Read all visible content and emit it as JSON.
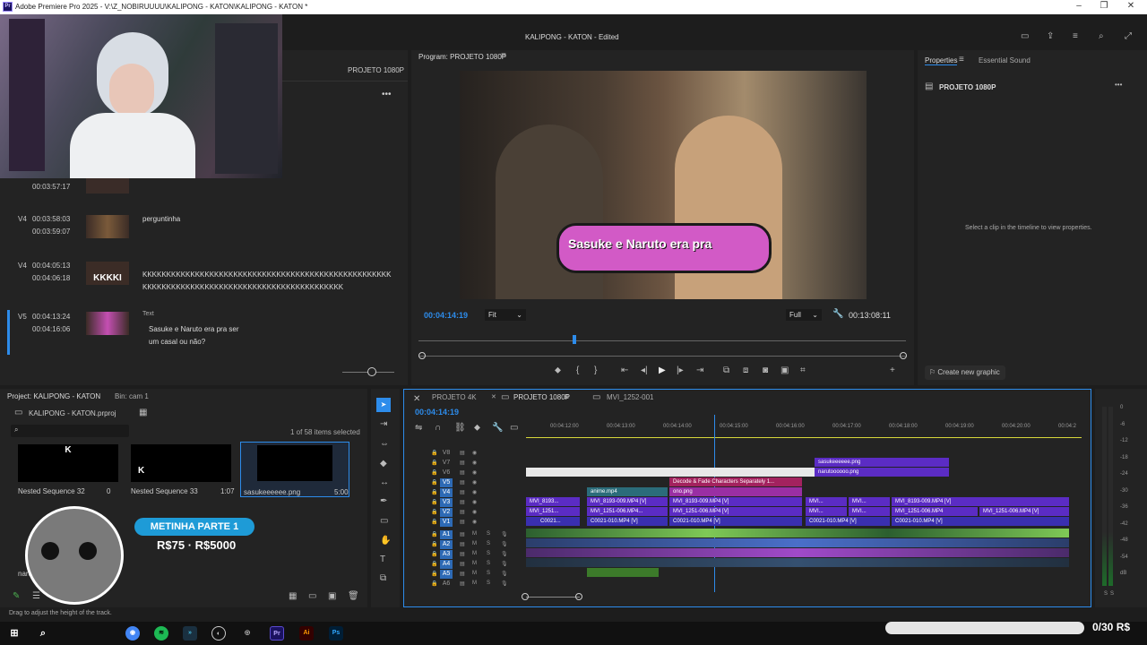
{
  "window": {
    "title": "Adobe Premiere Pro 2025 - V:\\Z_NOBIRUUUU\\KALIPONG - KATON\\KALIPONG - KATON *",
    "doc_title": "KALIPONG - KATON - Edited"
  },
  "source_panel": {
    "seq_name": "PROJETO 1080P",
    "rows": [
      {
        "track": "",
        "tin": "00:03:57:17",
        "tout": "",
        "text": "",
        "text2": ""
      },
      {
        "track": "V4",
        "tin": "00:03:58:03",
        "tout": "00:03:59:07",
        "text": "perguntinha",
        "text2": ""
      },
      {
        "track": "V4",
        "tin": "00:04:05:13",
        "tout": "00:04:06:18",
        "text": "KKKKKKKKKKKKKKKKKKKKKKKKKKKKKKKKKKKKKKKKKKKKKKKKKKKK",
        "text2": "KKKKKKKKKKKKKKKKKKKKKKKKKKKKKKKKKKKKKKKKKK"
      },
      {
        "track": "V5",
        "tin": "00:04:13:24",
        "tout": "00:04:16:06",
        "text": "Sasuke e Naruto era pra ser",
        "text2": "um casal ou não?"
      }
    ],
    "text_label": "Text",
    "thumb_text": "KKKKI"
  },
  "program": {
    "label": "Program: PROJETO 1080P",
    "caption": "Sasuke e Naruto era pra",
    "timecode": "00:04:14:19",
    "fit": "Fit",
    "full": "Full",
    "duration": "00:13:08:11"
  },
  "properties": {
    "tab1": "Properties",
    "tab2": "Essential Sound",
    "seq": "PROJETO 1080P",
    "empty": "Select a clip in the timeline to view properties.",
    "create": "Create new graphic"
  },
  "project": {
    "title": "Project: KALIPONG - KATON",
    "bin": "Bin: cam 1",
    "file": "KALIPONG - KATON.prproj",
    "count": "1 of 58 items selected",
    "items": [
      {
        "name": "Nested Sequence 32",
        "dur": "0",
        "letter": "K"
      },
      {
        "name": "Nested Sequence 33",
        "dur": "1:07",
        "letter": "K"
      },
      {
        "name": "sasukeeeeee.png",
        "dur": "5:00",
        "letter": ""
      }
    ],
    "extra": "naruto0000.png"
  },
  "timeline": {
    "tabs": [
      "PROJETO 4K",
      "PROJETO 1080P",
      "MVI_1252-001"
    ],
    "timecode": "00:04:14:19",
    "ruler": [
      "00:04:12:00",
      "00:04:13:00",
      "00:04:14:00",
      "00:04:15:00",
      "00:04:16:00",
      "00:04:17:00",
      "00:04:18:00",
      "00:04:19:00",
      "00:04:20:00",
      "00:04:2"
    ],
    "video_tracks": [
      "V8",
      "V7",
      "V6",
      "V5",
      "V4",
      "V3",
      "V2",
      "V1"
    ],
    "audio_tracks": [
      "A1",
      "A2",
      "A3",
      "A4",
      "A5",
      "A6"
    ],
    "clips": {
      "sasuke": "sasukeeeeee.png",
      "naruto": "narutoooooo.png",
      "decode": "Decode & Fade Characters Separately 1...",
      "anime": "anime.mp4",
      "ono": "ono.png",
      "v3a": "MVI_8193...",
      "v3b": "MVI_8193-009.MP4 [V]",
      "v3c": "MVI_8193-009.MP4 [V]",
      "v3d": "MVI...",
      "v3e": "MVI...",
      "v3f": "MVI_8193-009.MP4 [V]",
      "v2a": "MVI_1251...",
      "v2b": "MVI_1251-006.MP4...",
      "v2c": "MVI_1251-006.MP4 [V]",
      "v2d": "MVI...",
      "v2e": "MVI...",
      "v2f": "MVI_1251-006.MP4",
      "v2g": "MVI_1251-006.MP4 [V]",
      "v1a": "C0021...",
      "v1b": "C0021-010.MP4 [V]",
      "v1c": "C0021-010.MP4 [V]",
      "v1d": "C0021-010.MP4 [V]",
      "v1e": "C0021-010.MP4 [V]"
    }
  },
  "meters": [
    "0",
    "-6",
    "-12",
    "-18",
    "-24",
    "-30",
    "-36",
    "-42",
    "-48",
    "-54",
    "dB"
  ],
  "overlay": {
    "title": "METINHA PARTE 1",
    "prices": "R$75 · R$5000",
    "goal": "0/30 R$"
  },
  "status": "Drag to adjust the height of the track."
}
